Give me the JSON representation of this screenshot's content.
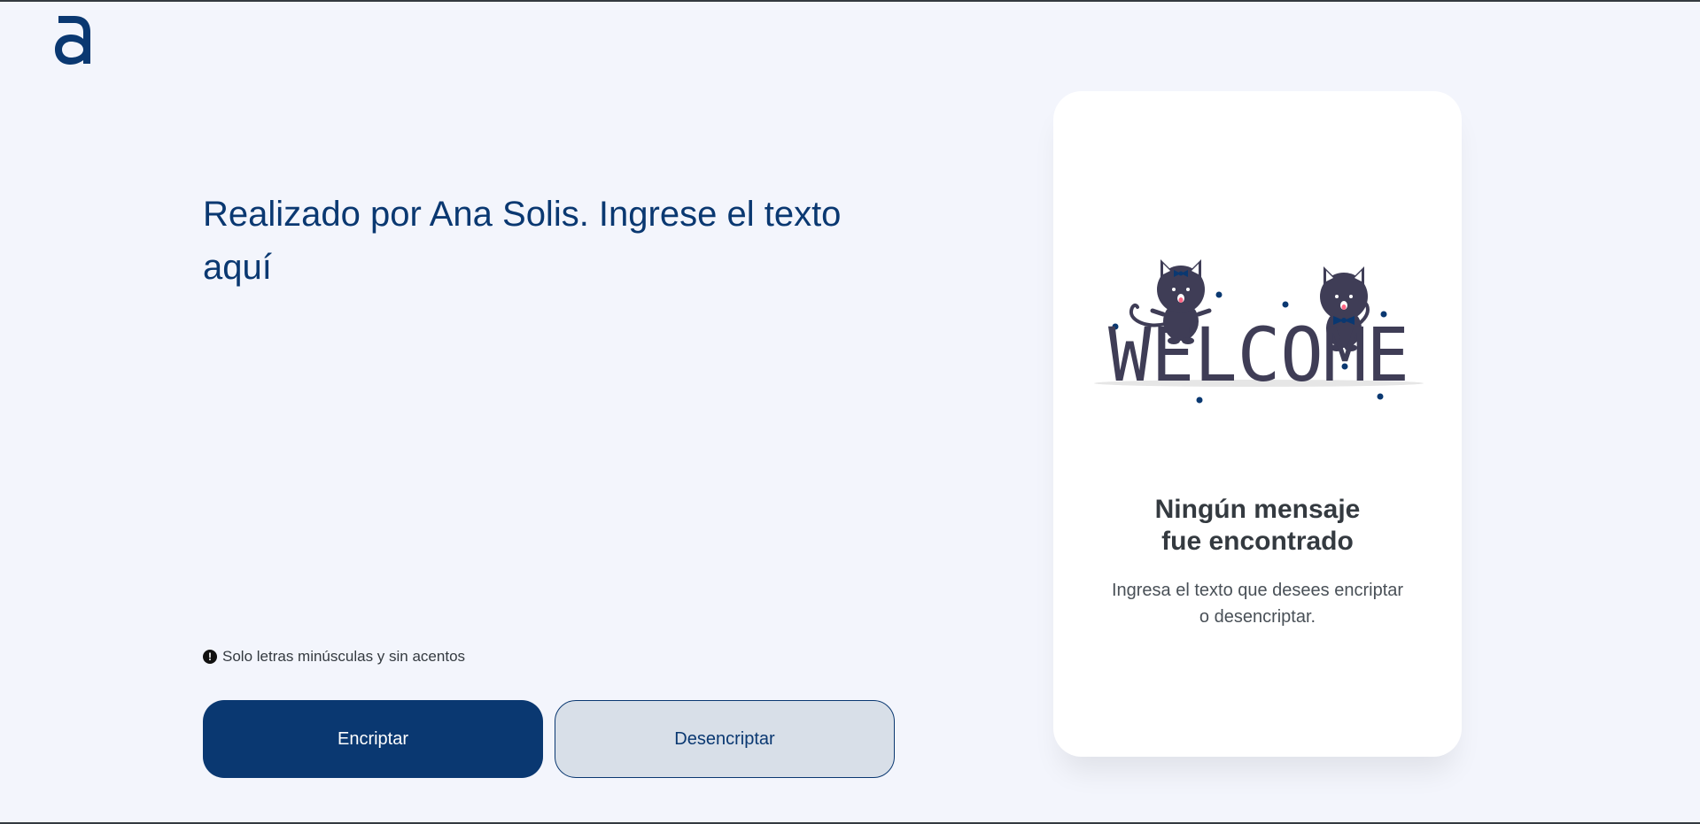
{
  "brand": {
    "logo_icon": "alura-a-logo-icon",
    "color": "#0a3871"
  },
  "input": {
    "placeholder": "Realizado por Ana Solis. Ingrese el texto aquí",
    "value": ""
  },
  "hint": {
    "icon": "exclamation-circle-icon",
    "text": "Solo letras minúsculas y sin acentos"
  },
  "buttons": {
    "encrypt_label": "Encriptar",
    "decrypt_label": "Desencriptar"
  },
  "output_panel": {
    "illustration": "welcome-cats-illustration",
    "illustration_text": "WELCOME",
    "title": "Ningún mensaje\nfue encontrado",
    "text": "Ingresa el texto que desees encriptar\no desencriptar."
  },
  "colors": {
    "background": "#f3f5fc",
    "primary": "#0a3871",
    "secondary_button": "#d8dfe8",
    "card": "#ffffff",
    "heading_text": "#343a40",
    "body_text": "#495057",
    "cat": "#3f3d56"
  }
}
